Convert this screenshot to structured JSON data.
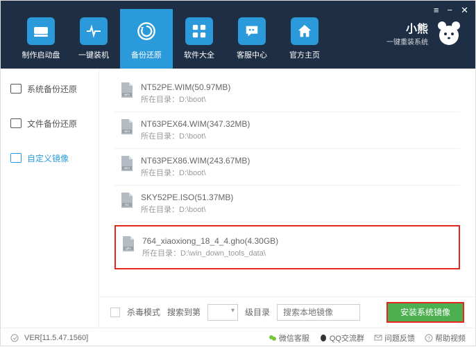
{
  "window": {
    "menu": "≡",
    "min": "−",
    "close": "✕"
  },
  "brand": {
    "title": "小熊",
    "subtitle": "一键重装系统"
  },
  "nav": [
    {
      "label": "制作启动盘"
    },
    {
      "label": "一键装机"
    },
    {
      "label": "备份还原"
    },
    {
      "label": "软件大全"
    },
    {
      "label": "客服中心"
    },
    {
      "label": "官方主页"
    }
  ],
  "sidebar": [
    {
      "label": "系统备份还原"
    },
    {
      "label": "文件备份还原"
    },
    {
      "label": "自定义镜像"
    }
  ],
  "path_prefix": "所在目录：",
  "files": [
    {
      "name": "NT52PE.WIM(50.97MB)",
      "path": "D:\\boot\\",
      "type": "wim"
    },
    {
      "name": "NT63PEX64.WIM(347.32MB)",
      "path": "D:\\boot\\",
      "type": "wim"
    },
    {
      "name": "NT63PEX86.WIM(243.67MB)",
      "path": "D:\\boot\\",
      "type": "wim"
    },
    {
      "name": "SKY52PE.ISO(51.37MB)",
      "path": "D:\\boot\\",
      "type": "iso"
    },
    {
      "name": "764_xiaoxiong_18_4_4.gho(4.30GB)",
      "path": "D:\\win_down_tools_data\\",
      "type": "gho",
      "highlighted": true
    }
  ],
  "actionbar": {
    "virus_mode": "杀毒模式",
    "search_to": "搜索到第",
    "level_value": "",
    "level_label": "级目录",
    "search_placeholder": "搜索本地镜像",
    "install_btn": "安装系统镜像"
  },
  "footer": {
    "version": "VER[11.5.47.1560]",
    "links": [
      {
        "label": "微信客服"
      },
      {
        "label": "QQ交流群"
      },
      {
        "label": "问题反馈"
      },
      {
        "label": "帮助视频"
      }
    ]
  }
}
